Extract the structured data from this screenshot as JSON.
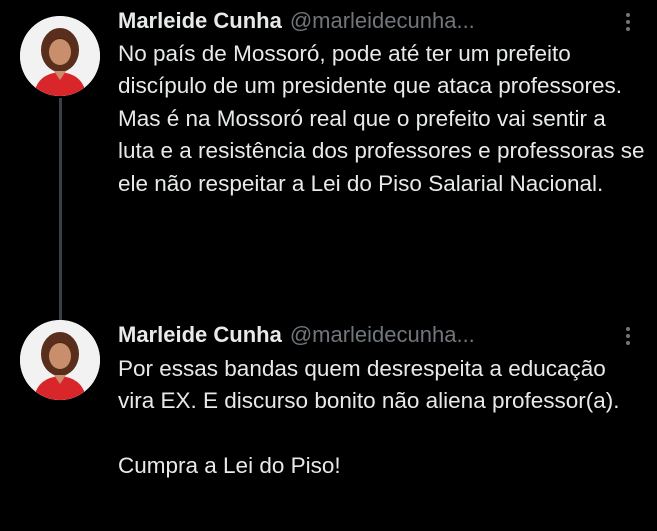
{
  "tweets": [
    {
      "author_name": "Marleide Cunha",
      "handle": "@marleidecunha...",
      "text": "No país de Mossoró, pode até ter um prefeito discípulo de um presidente que ataca professores. Mas é na Mossoró real que o prefeito vai sentir a luta e a resistência dos professores e professoras se ele não respeitar a Lei do Piso Salarial Nacional.",
      "avatar_icon": "profile-photo",
      "menu_icon": "more-vertical-icon"
    },
    {
      "author_name": "Marleide Cunha",
      "handle": "@marleidecunha...",
      "text": "Por essas bandas quem desrespeita a educação vira EX. E discurso bonito não aliena professor(a).\n\nCumpra a Lei do Piso!",
      "avatar_icon": "profile-photo",
      "menu_icon": "more-vertical-icon"
    }
  ],
  "colors": {
    "background": "#000000",
    "text": "#e7e9ea",
    "secondary": "#71767b",
    "thread_line": "#3a3f44",
    "avatar_shirt": "#d9262b"
  }
}
